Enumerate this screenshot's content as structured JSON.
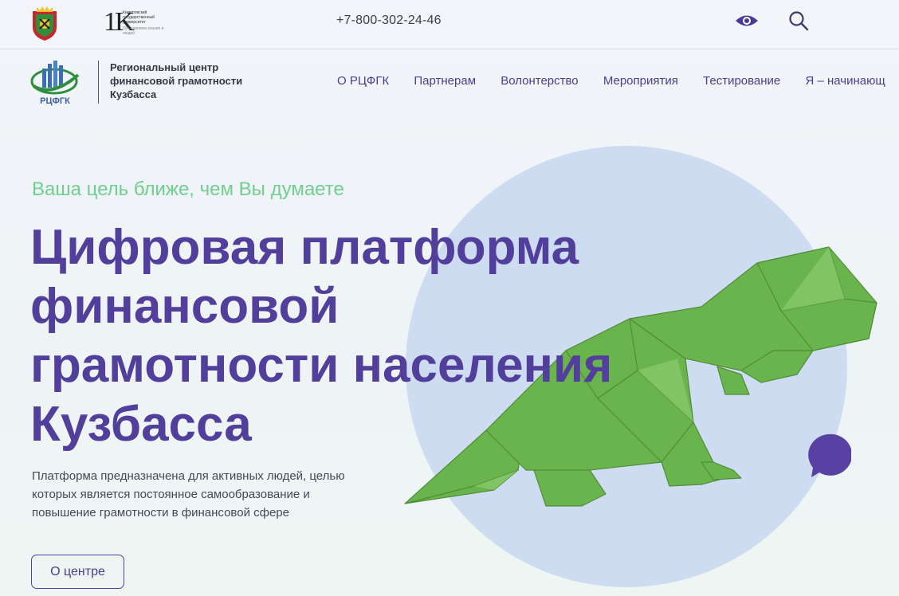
{
  "topbar": {
    "kemsu_title": "Кемеровский государственный университет",
    "kemsu_subtitle": "Объединяем знания и людей",
    "phone": "+7-800-302-24-46",
    "icons": {
      "accessibility": "eye-icon",
      "search": "search-icon"
    }
  },
  "header": {
    "logo_text": "РЦФГК",
    "org_name": "Региональный центр финансовой грамотности Кузбасса",
    "nav": [
      "О РЦФГК",
      "Партнерам",
      "Волонтерство",
      "Мероприятия",
      "Тестирование",
      "Я – начинающ"
    ]
  },
  "hero": {
    "tagline": "Ваша цель ближе, чем Вы думаете",
    "headline": "Цифровая платформа финансовой грамотности населения Кузбасса",
    "description": "Платформа предназначена для активных людей, целью которых является постоянное самообразование и повышение грамотности в финансовой сфере",
    "cta_label": "О центре"
  },
  "colors": {
    "accent": "#523f9c",
    "tagline": "#6fcf8f",
    "circle": "#cddcf1",
    "dino": "#6ab44e"
  }
}
